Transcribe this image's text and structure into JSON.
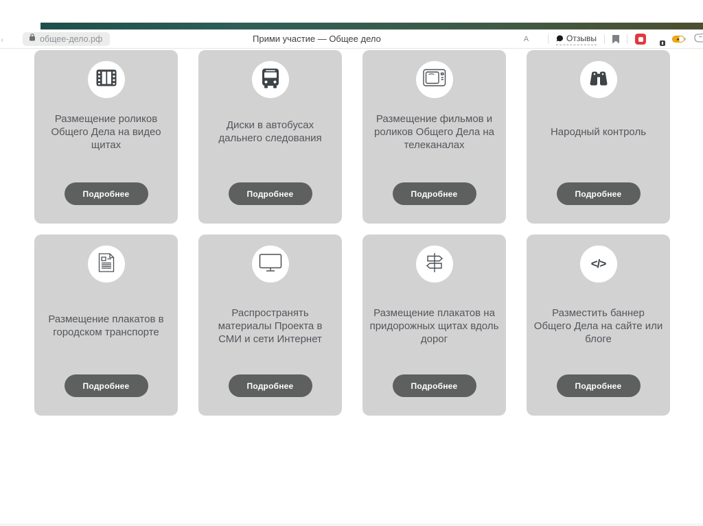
{
  "browser": {
    "url": "общее-дело.рф",
    "page_title": "Прими участие — Общее дело",
    "toolbar": {
      "reviews_label": "Отзывы",
      "translate_glyph": "A",
      "icon_names": [
        "lock-icon",
        "translate-icon",
        "reviews-bubble-icon",
        "bookmark-icon",
        "red-extension-icon",
        "green-extension-icon",
        "battery-extension-icon",
        "hand-extension-icon"
      ]
    },
    "accent_colors": {
      "top_bar_teal": "#2e5e57",
      "top_bar_olive": "#4d4f30"
    }
  },
  "cards": [
    {
      "icon": "film-icon",
      "title": "Размещение роликов Общего Дела на видео щитах",
      "button": "Подробнее"
    },
    {
      "icon": "bus-icon",
      "title": "Диски в автобусах дальнего следования",
      "button": "Подробнее"
    },
    {
      "icon": "tv-icon",
      "title": "Размещение фильмов и роликов Общего Дела на телеканалах",
      "button": "Подробнее"
    },
    {
      "icon": "binoculars-icon",
      "title": "Народный контроль",
      "button": "Подробнее"
    },
    {
      "icon": "poster-icon",
      "title": "Размещение плакатов в городском транспорте",
      "button": "Подробнее"
    },
    {
      "icon": "monitor-icon",
      "title": "Распространять материалы Проекта в СМИ и сети Интернет",
      "button": "Подробнее"
    },
    {
      "icon": "signpost-icon",
      "title": "Размещение плакатов на придорожных щитах вдоль дорог",
      "button": "Подробнее"
    },
    {
      "icon": "code-icon",
      "title": "Разместить баннер Общего Дела на сайте или блоге",
      "button": "Подробнее",
      "glyph": "</>"
    }
  ],
  "theme": {
    "card_bg": "#d2d2d2",
    "button_bg": "#5e5f5f",
    "icon_color": "#3e4347",
    "title_color": "#53565b"
  }
}
